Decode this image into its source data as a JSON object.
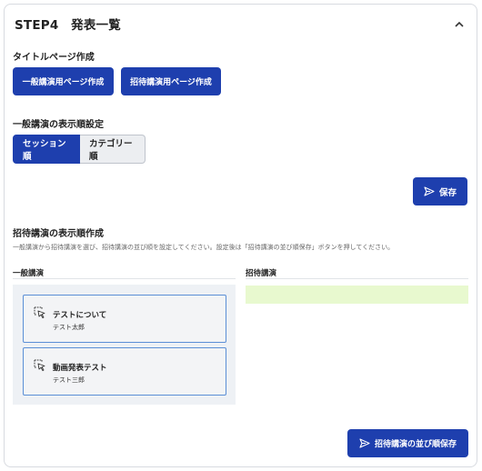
{
  "card": {
    "title": "STEP4　発表一覧"
  },
  "title_page": {
    "label": "タイトルページ作成",
    "general_button": "一般講演用ページ作成",
    "invited_button": "招待講演用ページ作成"
  },
  "display_order": {
    "label": "一般講演の表示順設定",
    "options": [
      "セッション順",
      "カテゴリー順"
    ],
    "selected": "セッション順",
    "save_button": "保存"
  },
  "invited_order": {
    "label": "招待講演の表示順作成",
    "description": "一般講演から招待講演を選び、招待講演の並び順を設定してください。設定後は「招待講演の並び順保存」ボタンを押してください。",
    "general_column": "一般講演",
    "invited_column": "招待講演",
    "general_items": [
      {
        "title": "テストについて",
        "author": "テスト太郎"
      },
      {
        "title": "動画発表テスト",
        "author": "テスト三郎"
      }
    ],
    "invited_items": [],
    "save_button": "招待講演の並び順保存"
  },
  "colors": {
    "primary": "#1e3fae",
    "drop_zone": "#e8f9cf",
    "pane": "#eef1f5",
    "item_border": "#5b8fd6"
  },
  "icons": {
    "collapse": "chevron-up-icon",
    "send": "send-icon",
    "drag": "drag-select-icon"
  }
}
